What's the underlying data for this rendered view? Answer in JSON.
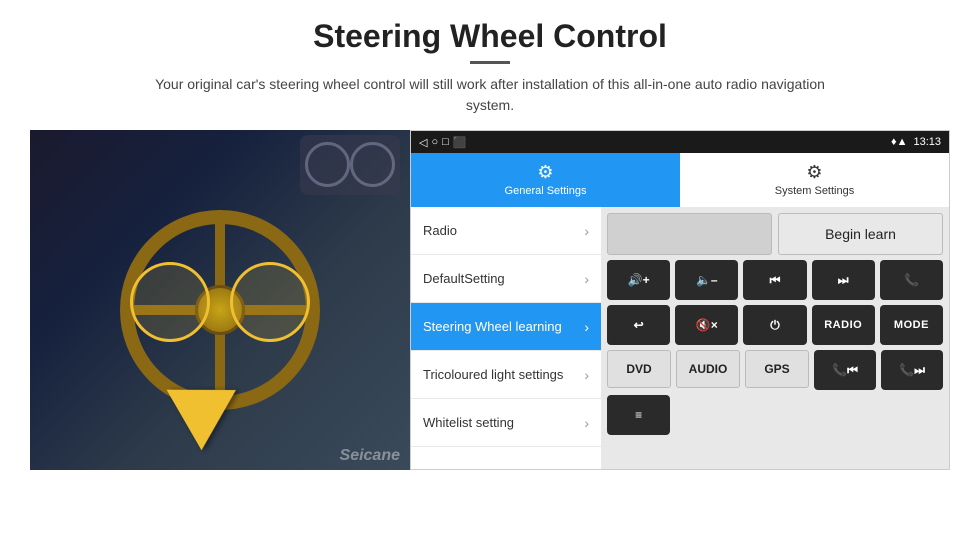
{
  "header": {
    "title": "Steering Wheel Control",
    "subtitle": "Your original car's steering wheel control will still work after installation of this all-in-one auto radio navigation system."
  },
  "statusBar": {
    "time": "13:13",
    "navButtons": [
      "◁",
      "○",
      "□",
      "⬛"
    ],
    "rightIcons": [
      "♦",
      "▲"
    ]
  },
  "tabs": [
    {
      "id": "general",
      "label": "General Settings",
      "active": true
    },
    {
      "id": "system",
      "label": "System Settings",
      "active": false
    }
  ],
  "menuItems": [
    {
      "id": "radio",
      "label": "Radio",
      "active": false
    },
    {
      "id": "default",
      "label": "DefaultSetting",
      "active": false
    },
    {
      "id": "steering",
      "label": "Steering Wheel learning",
      "active": true
    },
    {
      "id": "tricoloured",
      "label": "Tricoloured light settings",
      "active": false
    },
    {
      "id": "whitelist",
      "label": "Whitelist setting",
      "active": false
    }
  ],
  "controls": {
    "beginLearnLabel": "Begin learn",
    "buttons": {
      "row1": [
        {
          "id": "vol-up",
          "icon": "🔊+",
          "label": "Vol+"
        },
        {
          "id": "vol-down",
          "icon": "🔈-",
          "label": "Vol-"
        },
        {
          "id": "prev-track",
          "icon": "⏮",
          "label": "Prev"
        },
        {
          "id": "next-track",
          "icon": "⏭",
          "label": "Next"
        },
        {
          "id": "phone",
          "icon": "📞",
          "label": "Call"
        }
      ],
      "row2": [
        {
          "id": "hang-up",
          "icon": "↩",
          "label": "Hang"
        },
        {
          "id": "mute",
          "icon": "🔇×",
          "label": "Mute"
        },
        {
          "id": "power",
          "icon": "⏻",
          "label": "Power"
        },
        {
          "id": "radio-btn",
          "text": "RADIO",
          "label": "Radio"
        },
        {
          "id": "mode-btn",
          "text": "MODE",
          "label": "Mode"
        }
      ],
      "row3": [
        {
          "id": "dvd-btn",
          "text": "DVD",
          "label": "DVD"
        },
        {
          "id": "audio-btn",
          "text": "AUDIO",
          "label": "Audio"
        },
        {
          "id": "gps-btn",
          "text": "GPS",
          "label": "GPS"
        },
        {
          "id": "tel-prev",
          "icon": "📞⏮",
          "label": "Tel Prev"
        },
        {
          "id": "tel-next",
          "icon": "📞⏭",
          "label": "Tel Next"
        }
      ],
      "row4": [
        {
          "id": "menu-btn",
          "icon": "≡",
          "label": "Menu"
        }
      ]
    }
  },
  "watermark": "Seicane"
}
